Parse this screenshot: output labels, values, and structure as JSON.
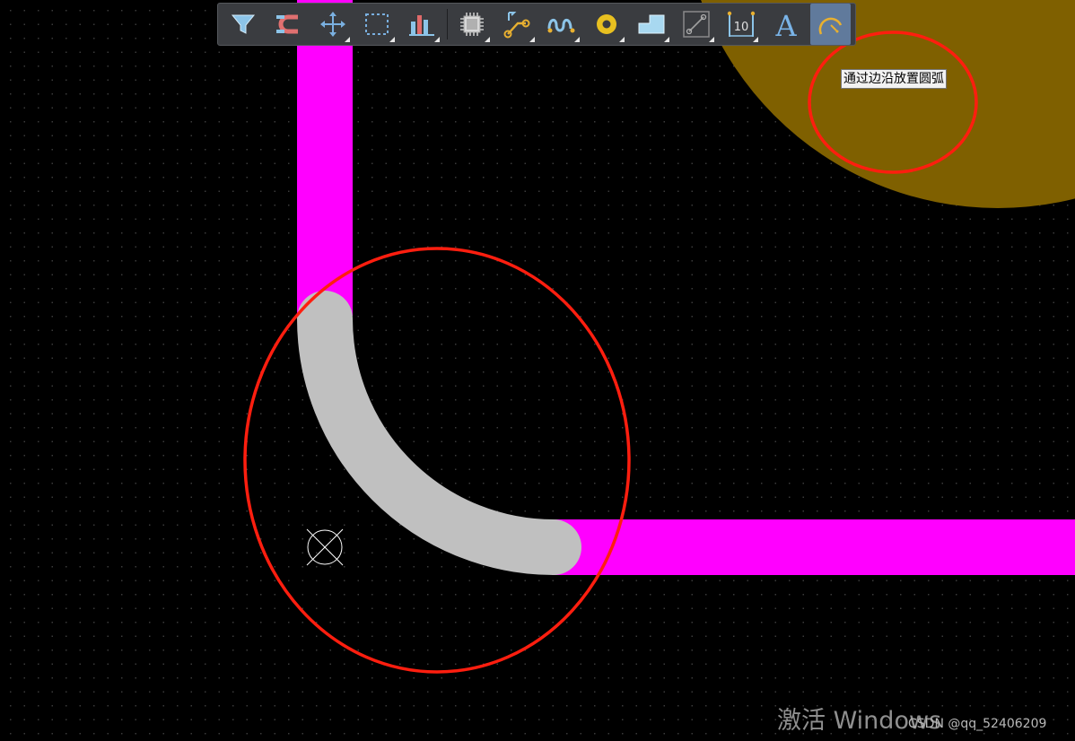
{
  "canvas": {
    "background_color": "#000000",
    "grid_dot_color": "#3c3c3c"
  },
  "colors": {
    "toolbar_bg": "#3a3c40",
    "active_button_bg": "#607a9c",
    "track": "#ff00ff",
    "arc_preview": "#c0c0c0",
    "copper_region": "#7f6000",
    "annotation_circle": "#ff1e0f",
    "tooltip_bg": "#f2f2f2"
  },
  "toolbar": {
    "buttons": [
      {
        "name": "filter-button",
        "icon": "filter-icon",
        "has_submenu": false,
        "active": false
      },
      {
        "name": "snap-button",
        "icon": "magnet-icon",
        "has_submenu": false,
        "active": false
      },
      {
        "name": "move-button",
        "icon": "move-icon",
        "has_submenu": true,
        "active": false
      },
      {
        "name": "select-button",
        "icon": "selection-rect-icon",
        "has_submenu": true,
        "active": false
      },
      {
        "name": "align-button",
        "icon": "align-icon",
        "has_submenu": true,
        "active": false
      },
      {
        "name": "component-button",
        "icon": "chip-icon",
        "has_submenu": true,
        "active": false
      },
      {
        "name": "route-button",
        "icon": "interactive-routing-icon",
        "has_submenu": true,
        "active": false
      },
      {
        "name": "tune-length-button",
        "icon": "length-tuning-icon",
        "has_submenu": true,
        "active": false
      },
      {
        "name": "via-button",
        "icon": "pad-via-icon",
        "has_submenu": true,
        "active": false
      },
      {
        "name": "polygon-button",
        "icon": "polygon-pour-icon",
        "has_submenu": true,
        "active": false
      },
      {
        "name": "connection-button",
        "icon": "line-connection-icon",
        "has_submenu": true,
        "active": false
      },
      {
        "name": "dimension-button",
        "icon": "dimension-icon",
        "has_submenu": true,
        "active": false
      },
      {
        "name": "text-button",
        "icon": "text-icon",
        "has_submenu": false,
        "active": false
      },
      {
        "name": "arc-button",
        "icon": "arc-icon",
        "has_submenu": false,
        "active": true
      }
    ],
    "dimension_icon_label": "10",
    "text_icon_label": "A"
  },
  "tooltip": {
    "text": "通过边沿放置圆弧"
  },
  "watermark": {
    "text": "激活 Windows"
  },
  "credit": {
    "text": "CSDN @qq_52406209"
  }
}
